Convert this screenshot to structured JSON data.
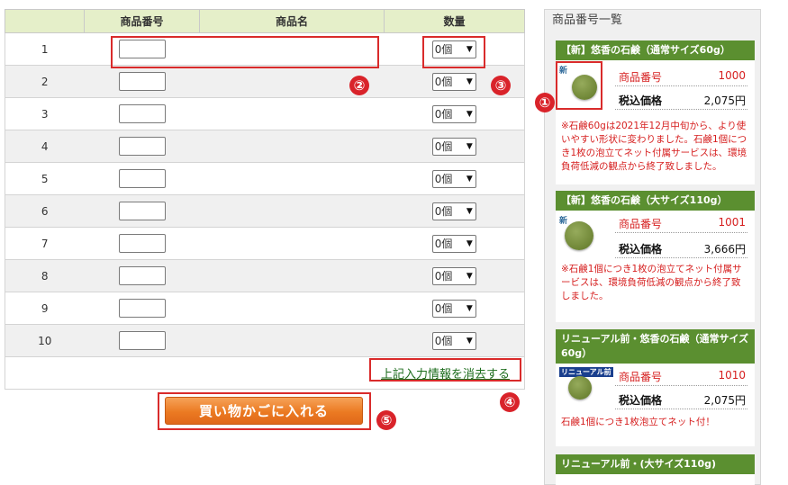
{
  "table": {
    "headers": [
      "",
      "商品番号",
      "商品名",
      "数量"
    ],
    "rows": [
      {
        "no": "1",
        "qty": "0個"
      },
      {
        "no": "2",
        "qty": "0個"
      },
      {
        "no": "3",
        "qty": "0個"
      },
      {
        "no": "4",
        "qty": "0個"
      },
      {
        "no": "5",
        "qty": "0個"
      },
      {
        "no": "6",
        "qty": "0個"
      },
      {
        "no": "7",
        "qty": "0個"
      },
      {
        "no": "8",
        "qty": "0個"
      },
      {
        "no": "9",
        "qty": "0個"
      },
      {
        "no": "10",
        "qty": "0個"
      }
    ],
    "clear_link": "上記入力情報を消去する"
  },
  "cart_button": "買い物かごに入れる",
  "annotations": [
    "①",
    "②",
    "③",
    "④",
    "⑤"
  ],
  "sidebar": {
    "title": "商品番号一覧",
    "code_label": "商品番号",
    "price_label": "税込価格",
    "products": [
      {
        "name": "【新】悠香の石鹸（通常サイズ60g）",
        "code": "1000",
        "price": "2,075円",
        "note": "※石鹸60gは2021年12月中旬から、より使いやすい形状に変わりました。石鹸1個につき1枚の泡立てネット付属サービスは、環境負荷低減の観点から終了致しました。",
        "badge": "新"
      },
      {
        "name": "【新】悠香の石鹸（大サイズ110g）",
        "code": "1001",
        "price": "3,666円",
        "note": "※石鹸1個につき1枚の泡立てネット付属サービスは、環境負荷低減の観点から終了致しました。",
        "badge": "新"
      },
      {
        "name": "リニューアル前・悠香の石鹸（通常サイズ60g）",
        "code": "1010",
        "price": "2,075円",
        "note": "石鹸1個につき1枚泡立てネット付！",
        "badge": "リニューアル前"
      },
      {
        "name": "リニューアル前・(大サイズ110g)"
      }
    ]
  },
  "colors": {
    "header_bg": "#e5efc9",
    "sidebar_head": "#5b8f30",
    "accent_red": "#d61f1f",
    "button_orange": "#eb7a22",
    "link_green": "#1d6d1d"
  }
}
